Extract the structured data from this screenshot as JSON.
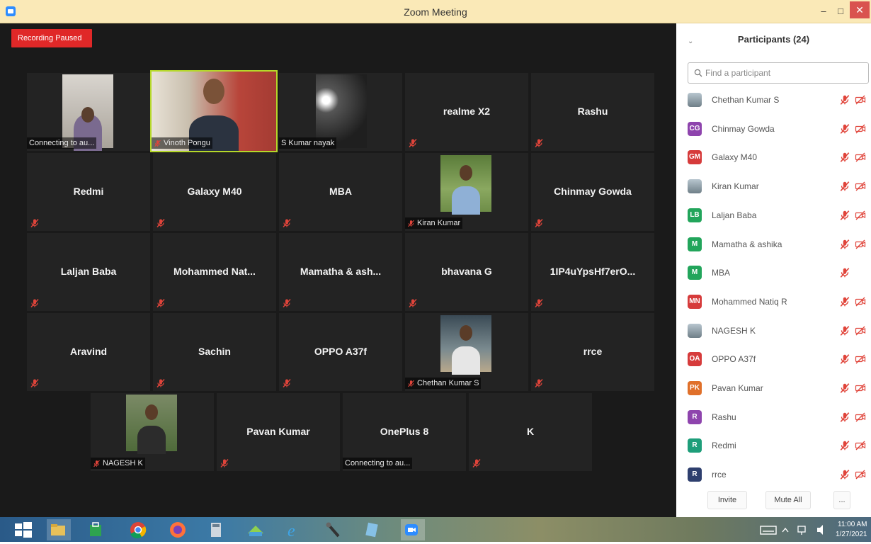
{
  "window": {
    "title": "Zoom Meeting",
    "minimize": "–",
    "maximize": "□",
    "close": "✕"
  },
  "meeting": {
    "recording_badge": "Recording Paused",
    "tiles": [
      {
        "name": "",
        "label": "Connecting to au...",
        "type": "video"
      },
      {
        "name": "",
        "label": "Vinoth Pongu",
        "type": "video"
      },
      {
        "name": "",
        "label": "S Kumar nayak",
        "type": "video"
      },
      {
        "name": "realme X2",
        "label": "",
        "type": "name"
      },
      {
        "name": "Rashu",
        "label": "",
        "type": "name"
      },
      {
        "name": "Redmi",
        "label": "",
        "type": "name"
      },
      {
        "name": "Galaxy M40",
        "label": "",
        "type": "name"
      },
      {
        "name": "MBA",
        "label": "",
        "type": "name"
      },
      {
        "name": "",
        "label": "Kiran Kumar",
        "type": "video"
      },
      {
        "name": "Chinmay Gowda",
        "label": "",
        "type": "name"
      },
      {
        "name": "Laljan Baba",
        "label": "",
        "type": "name"
      },
      {
        "name": "Mohammed Nat...",
        "label": "",
        "type": "name"
      },
      {
        "name": "Mamatha & ash...",
        "label": "",
        "type": "name"
      },
      {
        "name": "bhavana G",
        "label": "",
        "type": "name"
      },
      {
        "name": "1IP4uYpsHf7erO...",
        "label": "",
        "type": "name"
      },
      {
        "name": "Aravind",
        "label": "",
        "type": "name"
      },
      {
        "name": "Sachin",
        "label": "",
        "type": "name"
      },
      {
        "name": "OPPO A37f",
        "label": "",
        "type": "name"
      },
      {
        "name": "",
        "label": "Chethan Kumar S",
        "type": "video"
      },
      {
        "name": "rrce",
        "label": "",
        "type": "name"
      },
      {
        "name": "",
        "label": "NAGESH K",
        "type": "video"
      },
      {
        "name": "Pavan Kumar",
        "label": "",
        "type": "name"
      },
      {
        "name": "OnePlus 8",
        "label": "Connecting to au...",
        "type": "name"
      },
      {
        "name": "K",
        "label": "",
        "type": "name"
      }
    ]
  },
  "participants": {
    "title": "Participants (24)",
    "search_placeholder": "Find a participant",
    "list": [
      {
        "name": "Chethan Kumar S",
        "initials": "",
        "color": "",
        "video": true
      },
      {
        "name": "Chinmay Gowda",
        "initials": "CG",
        "color": "#8e44ad",
        "video": true
      },
      {
        "name": "Galaxy M40",
        "initials": "GM",
        "color": "#d63b3b",
        "video": true
      },
      {
        "name": "Kiran Kumar",
        "initials": "",
        "color": "",
        "video": true
      },
      {
        "name": "Laljan Baba",
        "initials": "LB",
        "color": "#22a55b",
        "video": true
      },
      {
        "name": "Mamatha & ashika",
        "initials": "M",
        "color": "#22a55b",
        "video": true
      },
      {
        "name": "MBA",
        "initials": "M",
        "color": "#22a55b",
        "video": false
      },
      {
        "name": "Mohammed Natiq R",
        "initials": "MN",
        "color": "#d63b3b",
        "video": true
      },
      {
        "name": "NAGESH K",
        "initials": "",
        "color": "",
        "video": true
      },
      {
        "name": "OPPO A37f",
        "initials": "OA",
        "color": "#d63b3b",
        "video": true
      },
      {
        "name": "Pavan Kumar",
        "initials": "PK",
        "color": "#e0702a",
        "video": true
      },
      {
        "name": "Rashu",
        "initials": "R",
        "color": "#8e44ad",
        "video": true
      },
      {
        "name": "Redmi",
        "initials": "R",
        "color": "#1e9e7a",
        "video": true
      },
      {
        "name": "rrce",
        "initials": "R",
        "color": "#2e3f6e",
        "video": true
      }
    ],
    "invite_label": "Invite",
    "mute_all_label": "Mute All",
    "more_label": "..."
  },
  "taskbar": {
    "time": "11:00 AM",
    "date": "1/27/2021"
  },
  "colors": {
    "accent_active_speaker": "#b5d82a",
    "recording": "#e02828",
    "muted_icon": "#e0443a"
  }
}
